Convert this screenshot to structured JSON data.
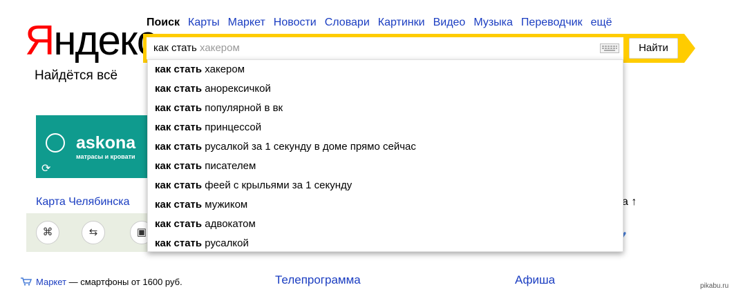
{
  "logo": {
    "first_letter": "Я",
    "rest": "ндекс"
  },
  "slogan": "Найдётся всё",
  "services": [
    "Поиск",
    "Карты",
    "Маркет",
    "Новости",
    "Словари",
    "Картинки",
    "Видео",
    "Музыка",
    "Переводчик",
    "ещё"
  ],
  "search": {
    "typed": "как стать",
    "hint": "хакером",
    "button_label": "Найти"
  },
  "suggestions": [
    {
      "prefix": "как стать",
      "rest": "хакером"
    },
    {
      "prefix": "как стать",
      "rest": "анорексичкой"
    },
    {
      "prefix": "как стать",
      "rest": "популярной в вк"
    },
    {
      "prefix": "как стать",
      "rest": "принцессой"
    },
    {
      "prefix": "как стать",
      "rest": "русалкой за 1 секунду в доме прямо сейчас"
    },
    {
      "prefix": "как стать",
      "rest": "писателем"
    },
    {
      "prefix": "как стать",
      "rest": "феей с крыльями за 1 секунду"
    },
    {
      "prefix": "как стать",
      "rest": "мужиком"
    },
    {
      "prefix": "как стать",
      "rest": "адвокатом"
    },
    {
      "prefix": "как стать",
      "rest": "русалкой"
    }
  ],
  "banner": {
    "title": "askona",
    "subtitle": "матрасы и кровати"
  },
  "map": {
    "title": "Карта Челябинска"
  },
  "right_peek": "а ↑",
  "market": {
    "link": "Маркет",
    "text": "— смартфоны от 1600 руб."
  },
  "tv_link": "Телепрограмма",
  "afisha_link": "Афиша",
  "watermark": "pikabu.ru",
  "colors": {
    "accent": "#ffcc00",
    "link": "#1a3dc1",
    "logo_red": "#ff0000",
    "banner": "#0f9b8e"
  }
}
